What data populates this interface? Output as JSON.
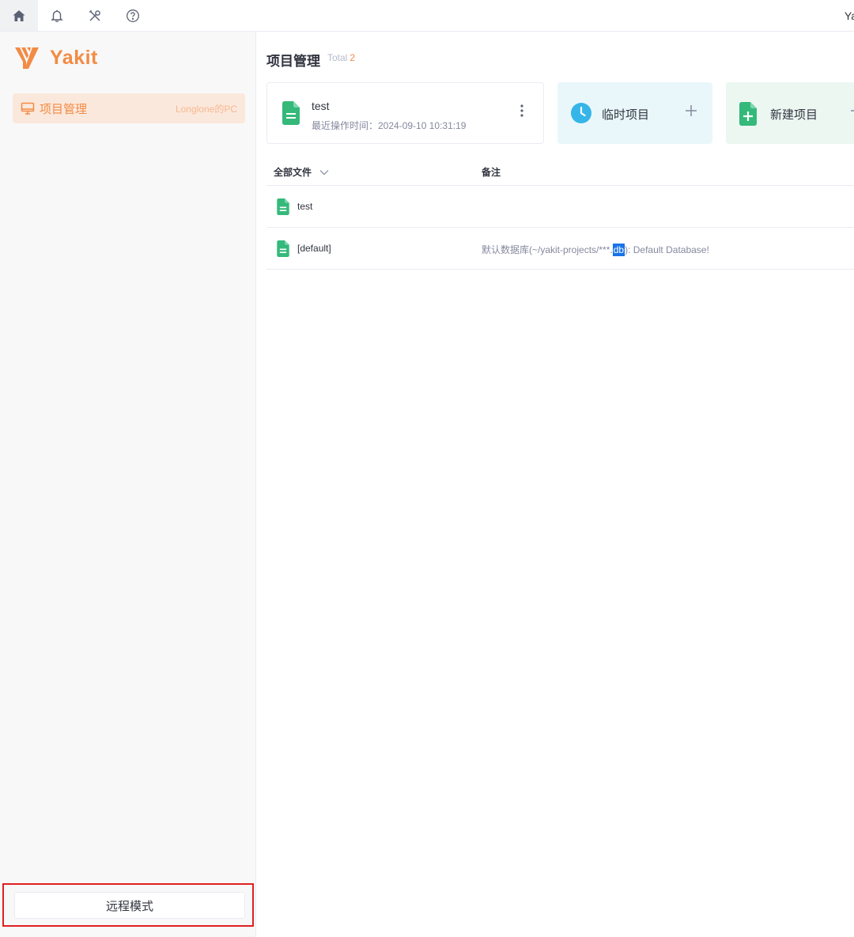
{
  "topbar": {
    "right_text": "Ya"
  },
  "sidebar": {
    "logo_text": "Yakit",
    "item": {
      "label": "项目管理",
      "sub": "Longlone的PC"
    },
    "remote_button": "远程模式"
  },
  "main": {
    "title": "项目管理",
    "total_label": "Total",
    "total_count": "2",
    "recent_card": {
      "name": "test",
      "time": "最近操作时间：2024-09-10 10:31:19"
    },
    "temp_card": {
      "label": "临时项目"
    },
    "new_card": {
      "label": "新建项目"
    },
    "table": {
      "col_files": "全部文件",
      "col_note": "备注",
      "rows": [
        {
          "name": "test",
          "note_before": "",
          "note_highlight": "",
          "note_after": ""
        },
        {
          "name": "[default]",
          "note_before": "默认数据库(~/yakit-projects/***.",
          "note_highlight": "db",
          "note_after": "): Default Database!"
        }
      ]
    }
  },
  "colors": {
    "accent": "#f28b44",
    "file_green": "#34b97a",
    "clock_blue": "#36b5e8",
    "highlight_blue": "#1a73e8",
    "annotation_red": "#e02020"
  }
}
